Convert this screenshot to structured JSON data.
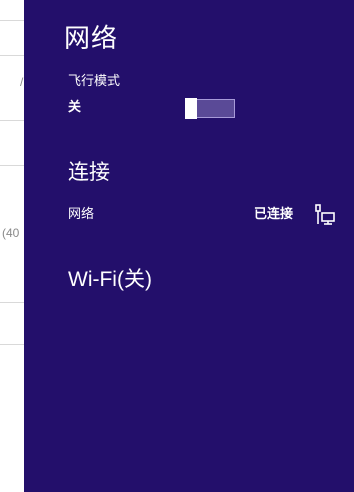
{
  "background_window": {
    "fragment_a": "/",
    "fragment_b": "(40"
  },
  "panel": {
    "title": "网络",
    "airplane_mode": {
      "label": "飞行模式",
      "state": "关"
    },
    "connections_title": "连接",
    "network": {
      "name": "网络",
      "status": "已连接",
      "icon": "wired-network-icon"
    },
    "wifi": {
      "label": "Wi-Fi(关)"
    }
  },
  "colors": {
    "panel_background": "#230f6b",
    "toggle_track": "#5a4a97",
    "text": "#ffffff"
  }
}
